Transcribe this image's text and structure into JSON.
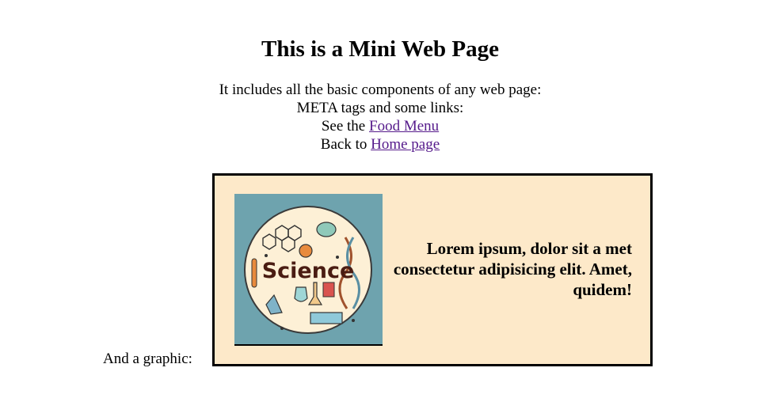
{
  "page": {
    "title": "This is a Mini Web Page",
    "intro_line1": "It includes all the basic components of any web page:",
    "intro_line2": "META tags and some links:",
    "food_prefix": "See the",
    "food_link": "Food Menu",
    "home_prefix": "Back to",
    "home_link": "Home page",
    "graphic_label": "And a graphic:"
  },
  "graphic": {
    "image_text": "Science",
    "caption": "Lorem ipsum, dolor sit a met consectetur adipisicing elit. Amet, quidem!",
    "tile_color": "#6ea3ae",
    "box_color": "#fde9c9",
    "circle_color": "#fdf0d6",
    "image_icon": "science-illustration"
  },
  "colors": {
    "link_visited": "#551a8b",
    "text": "#000000"
  }
}
